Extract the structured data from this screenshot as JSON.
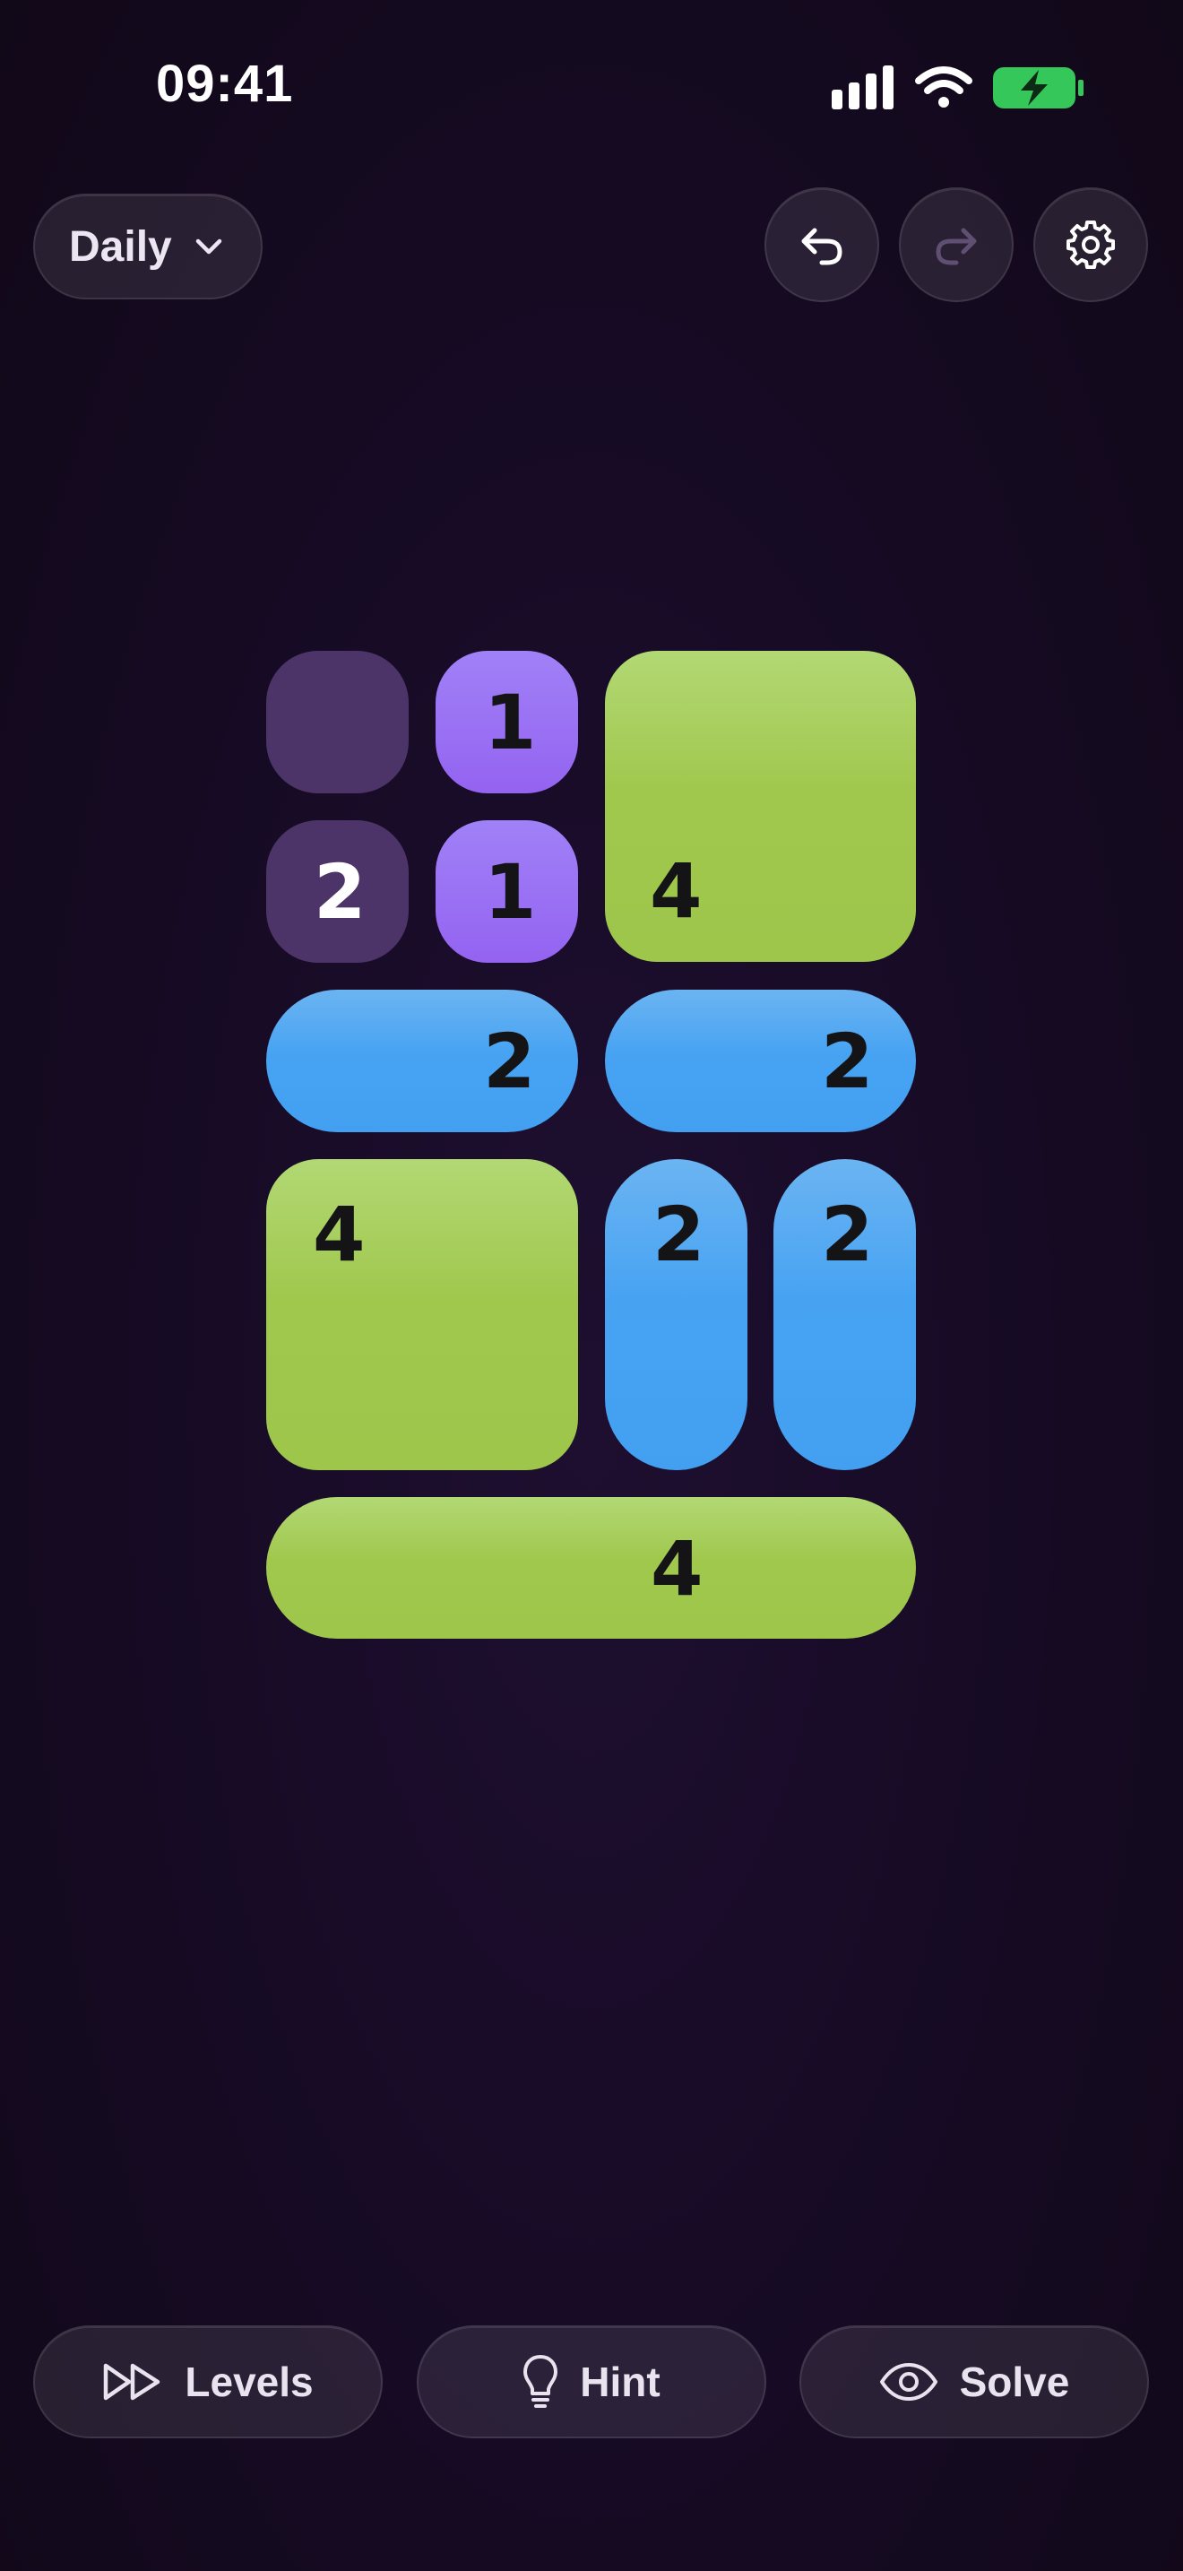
{
  "status_bar": {
    "time": "09:41"
  },
  "toolbar": {
    "mode_label": "Daily",
    "undo_icon": "undo-arrow-icon",
    "redo_icon": "redo-arrow-icon",
    "settings_icon": "gear-icon"
  },
  "board": {
    "colors": {
      "empty": "#4d3468",
      "purple": "#9463f1",
      "green": "#a0c84d",
      "blue": "#47a3f2"
    },
    "tiles": [
      {
        "id": "a",
        "color": "empty",
        "number": ""
      },
      {
        "id": "b",
        "color": "purple",
        "number": "1"
      },
      {
        "id": "c",
        "color": "green",
        "number": "4"
      },
      {
        "id": "d",
        "color": "empty",
        "number": "2"
      },
      {
        "id": "e",
        "color": "purple",
        "number": "1"
      },
      {
        "id": "f",
        "color": "blue",
        "number": "2"
      },
      {
        "id": "g",
        "color": "blue",
        "number": "2"
      },
      {
        "id": "h",
        "color": "green",
        "number": "4"
      },
      {
        "id": "i",
        "color": "blue",
        "number": "2"
      },
      {
        "id": "j",
        "color": "blue",
        "number": "2"
      },
      {
        "id": "k",
        "color": "green",
        "number": "4"
      }
    ]
  },
  "actions": {
    "levels_label": "Levels",
    "hint_label": "Hint",
    "solve_label": "Solve"
  }
}
